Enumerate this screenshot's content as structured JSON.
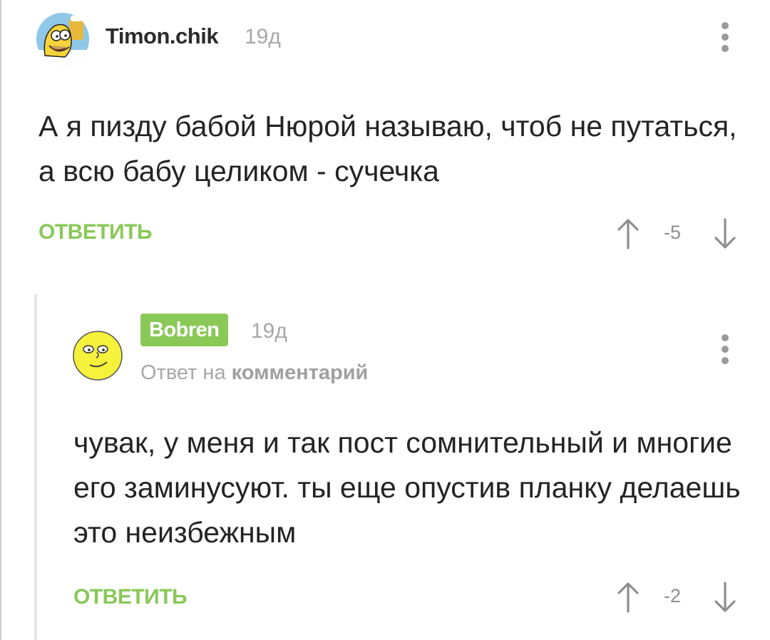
{
  "comment": {
    "username": "Timon.chik",
    "time": "19д",
    "text": "А я пизду бабой Нюрой называю, чтоб не путаться, а всю бабу целиком - сучечка",
    "reply_label": "ОТВЕТИТЬ",
    "rating": "-5",
    "avatar_icon": "homer-avatar-icon",
    "more_icon": "more-vertical-icon"
  },
  "reply": {
    "username": "Bobren",
    "time": "19д",
    "reply_to_prefix": "Ответ на",
    "reply_to_link": "комментарий",
    "text": "чувак, у меня и так пост сомнительный и многие его заминусуют. ты еще опустив планку делаешь это неизбежным",
    "reply_label": "ОТВЕТИТЬ",
    "rating": "-2",
    "avatar_icon": "smiley-avatar-icon",
    "more_icon": "more-vertical-icon"
  },
  "colors": {
    "accent_green": "#8ac858",
    "text_dark": "#242424",
    "text_muted": "#a8a8a8",
    "thread_line": "#e6e6e6"
  }
}
